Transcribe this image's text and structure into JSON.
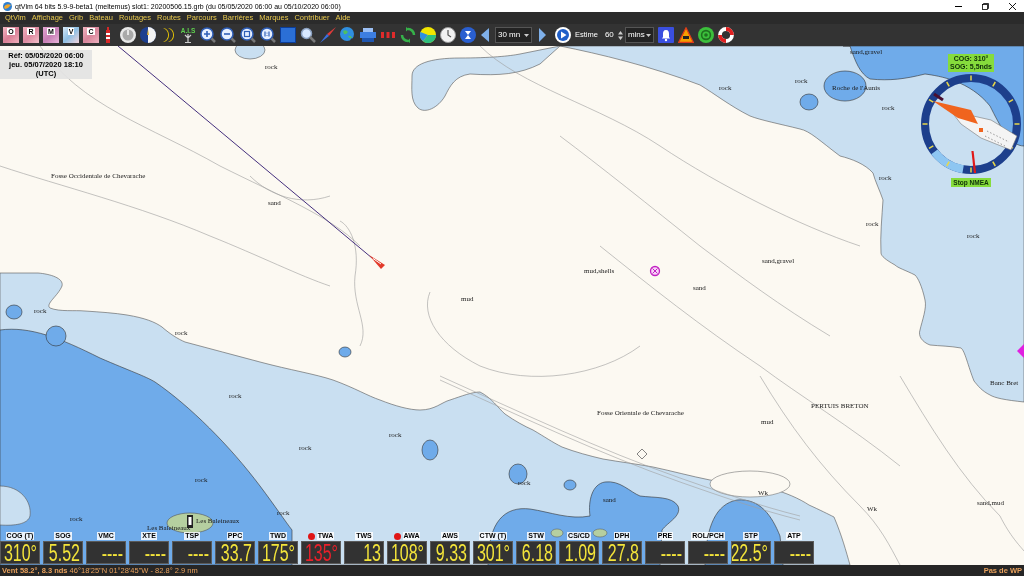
{
  "window": {
    "title": "qtVlm 64 bits 5.9-9-beta1 (meltemus) slot1: 20200506.15.grb (du 05/05/2020 06:00 au 05/10/2020 06:00)"
  },
  "menu": [
    "QtVlm",
    "Affichage",
    "Grib",
    "Bateau",
    "Routages",
    "Routes",
    "Parcours",
    "Barrières",
    "Marques",
    "Contribuer",
    "Aide"
  ],
  "toolbar": {
    "map_layers": [
      {
        "label": "O"
      },
      {
        "label": "R"
      },
      {
        "label": "M"
      },
      {
        "label": "V"
      },
      {
        "label": "C"
      }
    ],
    "ais_label": "A.I.S",
    "step": "30 mn",
    "estime_label": "Estime",
    "estime_value": "60",
    "estime_unit": "mins"
  },
  "date_panel": {
    "reference": "Réf: 05/05/2020 06:00",
    "current": "jeu. 05/07/2020 18:10",
    "timezone": "(UTC)"
  },
  "chart_labels": [
    {
      "text": "rock"
    },
    {
      "text": "sand,gravel"
    },
    {
      "text": "rock"
    },
    {
      "text": "rock"
    },
    {
      "text": "Roche de l'Aunis"
    },
    {
      "text": "rock"
    },
    {
      "text": "Fosse Occidentale de Chevarache"
    },
    {
      "text": "sand"
    },
    {
      "text": "rock"
    },
    {
      "text": "rock"
    },
    {
      "text": "rock"
    },
    {
      "text": "sand,gravel"
    },
    {
      "text": "mud,shells"
    },
    {
      "text": "sand"
    },
    {
      "text": "mud"
    },
    {
      "text": "rock"
    },
    {
      "text": "rock"
    },
    {
      "text": "rock"
    },
    {
      "text": "PERTUIS BRETON"
    },
    {
      "text": "Fosse Orientale de Chevarache"
    },
    {
      "text": "Banc Bret"
    },
    {
      "text": "mud"
    },
    {
      "text": "rock"
    },
    {
      "text": "rock"
    },
    {
      "text": "rock"
    },
    {
      "text": "rock"
    },
    {
      "text": "rock"
    },
    {
      "text": "rock"
    },
    {
      "text": "Les Baleineaux"
    },
    {
      "text": "Les Baleineaux"
    },
    {
      "text": "sand"
    },
    {
      "text": "Wk"
    },
    {
      "text": "Wk"
    },
    {
      "text": "sand,mud"
    }
  ],
  "compass": {
    "cog": "COG: 310°",
    "sog": "SOG: 5,5nds",
    "stop_button": "Stop NMEA"
  },
  "instruments": [
    {
      "label": "COG (T)",
      "value": "310°",
      "flagged": false,
      "alarm": false
    },
    {
      "label": "SOG",
      "value": "5.52",
      "flagged": false,
      "alarm": false
    },
    {
      "label": "VMC",
      "value": "----",
      "flagged": false,
      "alarm": false
    },
    {
      "label": "XTE",
      "value": "----",
      "flagged": false,
      "alarm": false
    },
    {
      "label": "TSP",
      "value": "----",
      "flagged": false,
      "alarm": false
    },
    {
      "label": "PPC",
      "value": "33.7",
      "flagged": false,
      "alarm": false
    },
    {
      "label": "TWD",
      "value": "175°",
      "flagged": false,
      "alarm": false
    },
    {
      "label": "TWA",
      "value": "135°",
      "flagged": true,
      "alarm": true
    },
    {
      "label": "TWS",
      "value": "13",
      "flagged": false,
      "alarm": false
    },
    {
      "label": "AWA",
      "value": "108°",
      "flagged": true,
      "alarm": false
    },
    {
      "label": "AWS",
      "value": "9.33",
      "flagged": false,
      "alarm": false
    },
    {
      "label": "CTW (T)",
      "value": "301°",
      "flagged": false,
      "alarm": false
    },
    {
      "label": "STW",
      "value": "6.18",
      "flagged": false,
      "alarm": false
    },
    {
      "label": "CS/CD",
      "value": "1.09",
      "flagged": false,
      "alarm": false
    },
    {
      "label": "DPH",
      "value": "27.8",
      "flagged": false,
      "alarm": false
    },
    {
      "label": "PRE",
      "value": "----",
      "flagged": false,
      "alarm": false
    },
    {
      "label": "ROL/PCH",
      "value": "----",
      "flagged": false,
      "alarm": false
    },
    {
      "label": "STP",
      "value": "22.5°",
      "flagged": false,
      "alarm": false
    },
    {
      "label": "ATP",
      "value": "----",
      "flagged": false,
      "alarm": false
    }
  ],
  "status_bar": {
    "position": "**Vent 58.2°, 8.3 nds** 46°18'25\"N 01°28'45\"W - 82.8° 2.9 nm",
    "waypoint": "Pas de WP"
  }
}
